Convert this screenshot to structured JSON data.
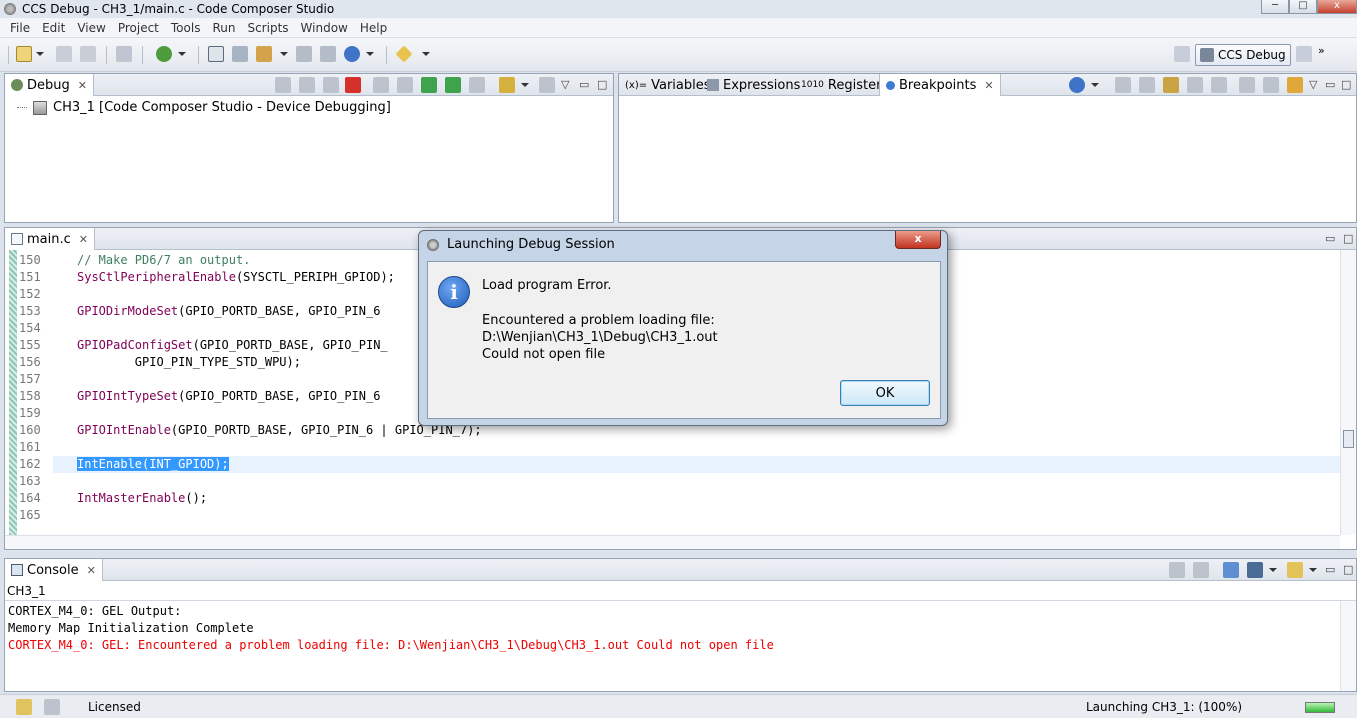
{
  "window": {
    "title": "CCS Debug - CH3_1/main.c - Code Composer Studio",
    "controls": {
      "minimize": "─",
      "maximize": "□",
      "close": "x"
    }
  },
  "menu": [
    "File",
    "Edit",
    "View",
    "Project",
    "Tools",
    "Run",
    "Scripts",
    "Window",
    "Help"
  ],
  "toolbar": {
    "perspective_label": "CCS Debug",
    "more_label": "»",
    "icons": [
      "new-icon",
      "save-icon",
      "save-all-icon",
      "print-icon",
      "debug-icon",
      "connect-icon",
      "load-program-icon",
      "breakpoint-icon",
      "external-tools-icon"
    ]
  },
  "debug_view": {
    "tab_label": "Debug",
    "tree_item": "CH3_1 [Code Composer Studio - Device Debugging]"
  },
  "right_view": {
    "tabs": [
      "Variables",
      "Expressions",
      "Registers",
      "Breakpoints"
    ],
    "tab_prefixes": [
      "(x)=",
      "",
      "1010",
      ""
    ]
  },
  "editor": {
    "tab_label": "main.c",
    "line_numbers": [
      "150",
      "151",
      "152",
      "153",
      "154",
      "155",
      "156",
      "157",
      "158",
      "159",
      "160",
      "161",
      "162",
      "163",
      "164",
      "165"
    ],
    "lines": [
      {
        "parts": [
          {
            "t": "// Make PD6/7 an output.",
            "c": "cmt"
          }
        ]
      },
      {
        "parts": [
          {
            "t": "SysCtlPeripheralEnable",
            "c": "fn"
          },
          {
            "t": "(SYSCTL_PERIPH_GPIOD);",
            "c": ""
          }
        ]
      },
      {
        "parts": []
      },
      {
        "parts": [
          {
            "t": "GPIODirModeSet",
            "c": "fn"
          },
          {
            "t": "(GPIO_PORTD_BASE, GPIO_PIN_6",
            "c": ""
          }
        ]
      },
      {
        "parts": []
      },
      {
        "parts": [
          {
            "t": "GPIOPadConfigSet",
            "c": "fn"
          },
          {
            "t": "(GPIO_PORTD_BASE, GPIO_PIN_",
            "c": ""
          }
        ]
      },
      {
        "parts": [
          {
            "t": "        GPIO_PIN_TYPE_STD_WPU);",
            "c": ""
          }
        ]
      },
      {
        "parts": []
      },
      {
        "parts": [
          {
            "t": "GPIOIntTypeSet",
            "c": "fn"
          },
          {
            "t": "(GPIO_PORTD_BASE, GPIO_PIN_6",
            "c": ""
          }
        ]
      },
      {
        "parts": []
      },
      {
        "parts": [
          {
            "t": "GPIOIntEnable",
            "c": "fn"
          },
          {
            "t": "(GPIO_PORTD_BASE, GPIO_PIN_6 | GPIO_PIN_7);",
            "c": ""
          }
        ]
      },
      {
        "parts": []
      },
      {
        "parts": [
          {
            "t": "IntEnable(INT_GPIOD);",
            "c": "sel"
          }
        ]
      },
      {
        "parts": []
      },
      {
        "parts": [
          {
            "t": "IntMasterEnable",
            "c": "fn"
          },
          {
            "t": "();",
            "c": ""
          }
        ]
      },
      {
        "parts": []
      }
    ]
  },
  "console": {
    "tab_label": "Console",
    "session": "CH3_1",
    "lines": [
      {
        "text": "CORTEX_M4_0: GEL Output:",
        "error": false
      },
      {
        "text": "Memory Map Initialization Complete",
        "error": false
      },
      {
        "text": "CORTEX_M4_0: GEL: Encountered a problem loading file: D:\\Wenjian\\CH3_1\\Debug\\CH3_1.out Could not open file",
        "error": true
      }
    ]
  },
  "status": {
    "license": "Licensed",
    "progress_text": "Launching CH3_1: (100%)",
    "progress_fraction": 1.0
  },
  "dialog": {
    "title": "Launching Debug Session",
    "close_label": "x",
    "icon_glyph": "i",
    "message_title": "Load program Error.",
    "detail_line1": "Encountered a problem loading file: D:\\Wenjian\\CH3_1\\Debug\\CH3_1.out",
    "detail_line2": "Could not open file",
    "ok_label": "OK"
  }
}
